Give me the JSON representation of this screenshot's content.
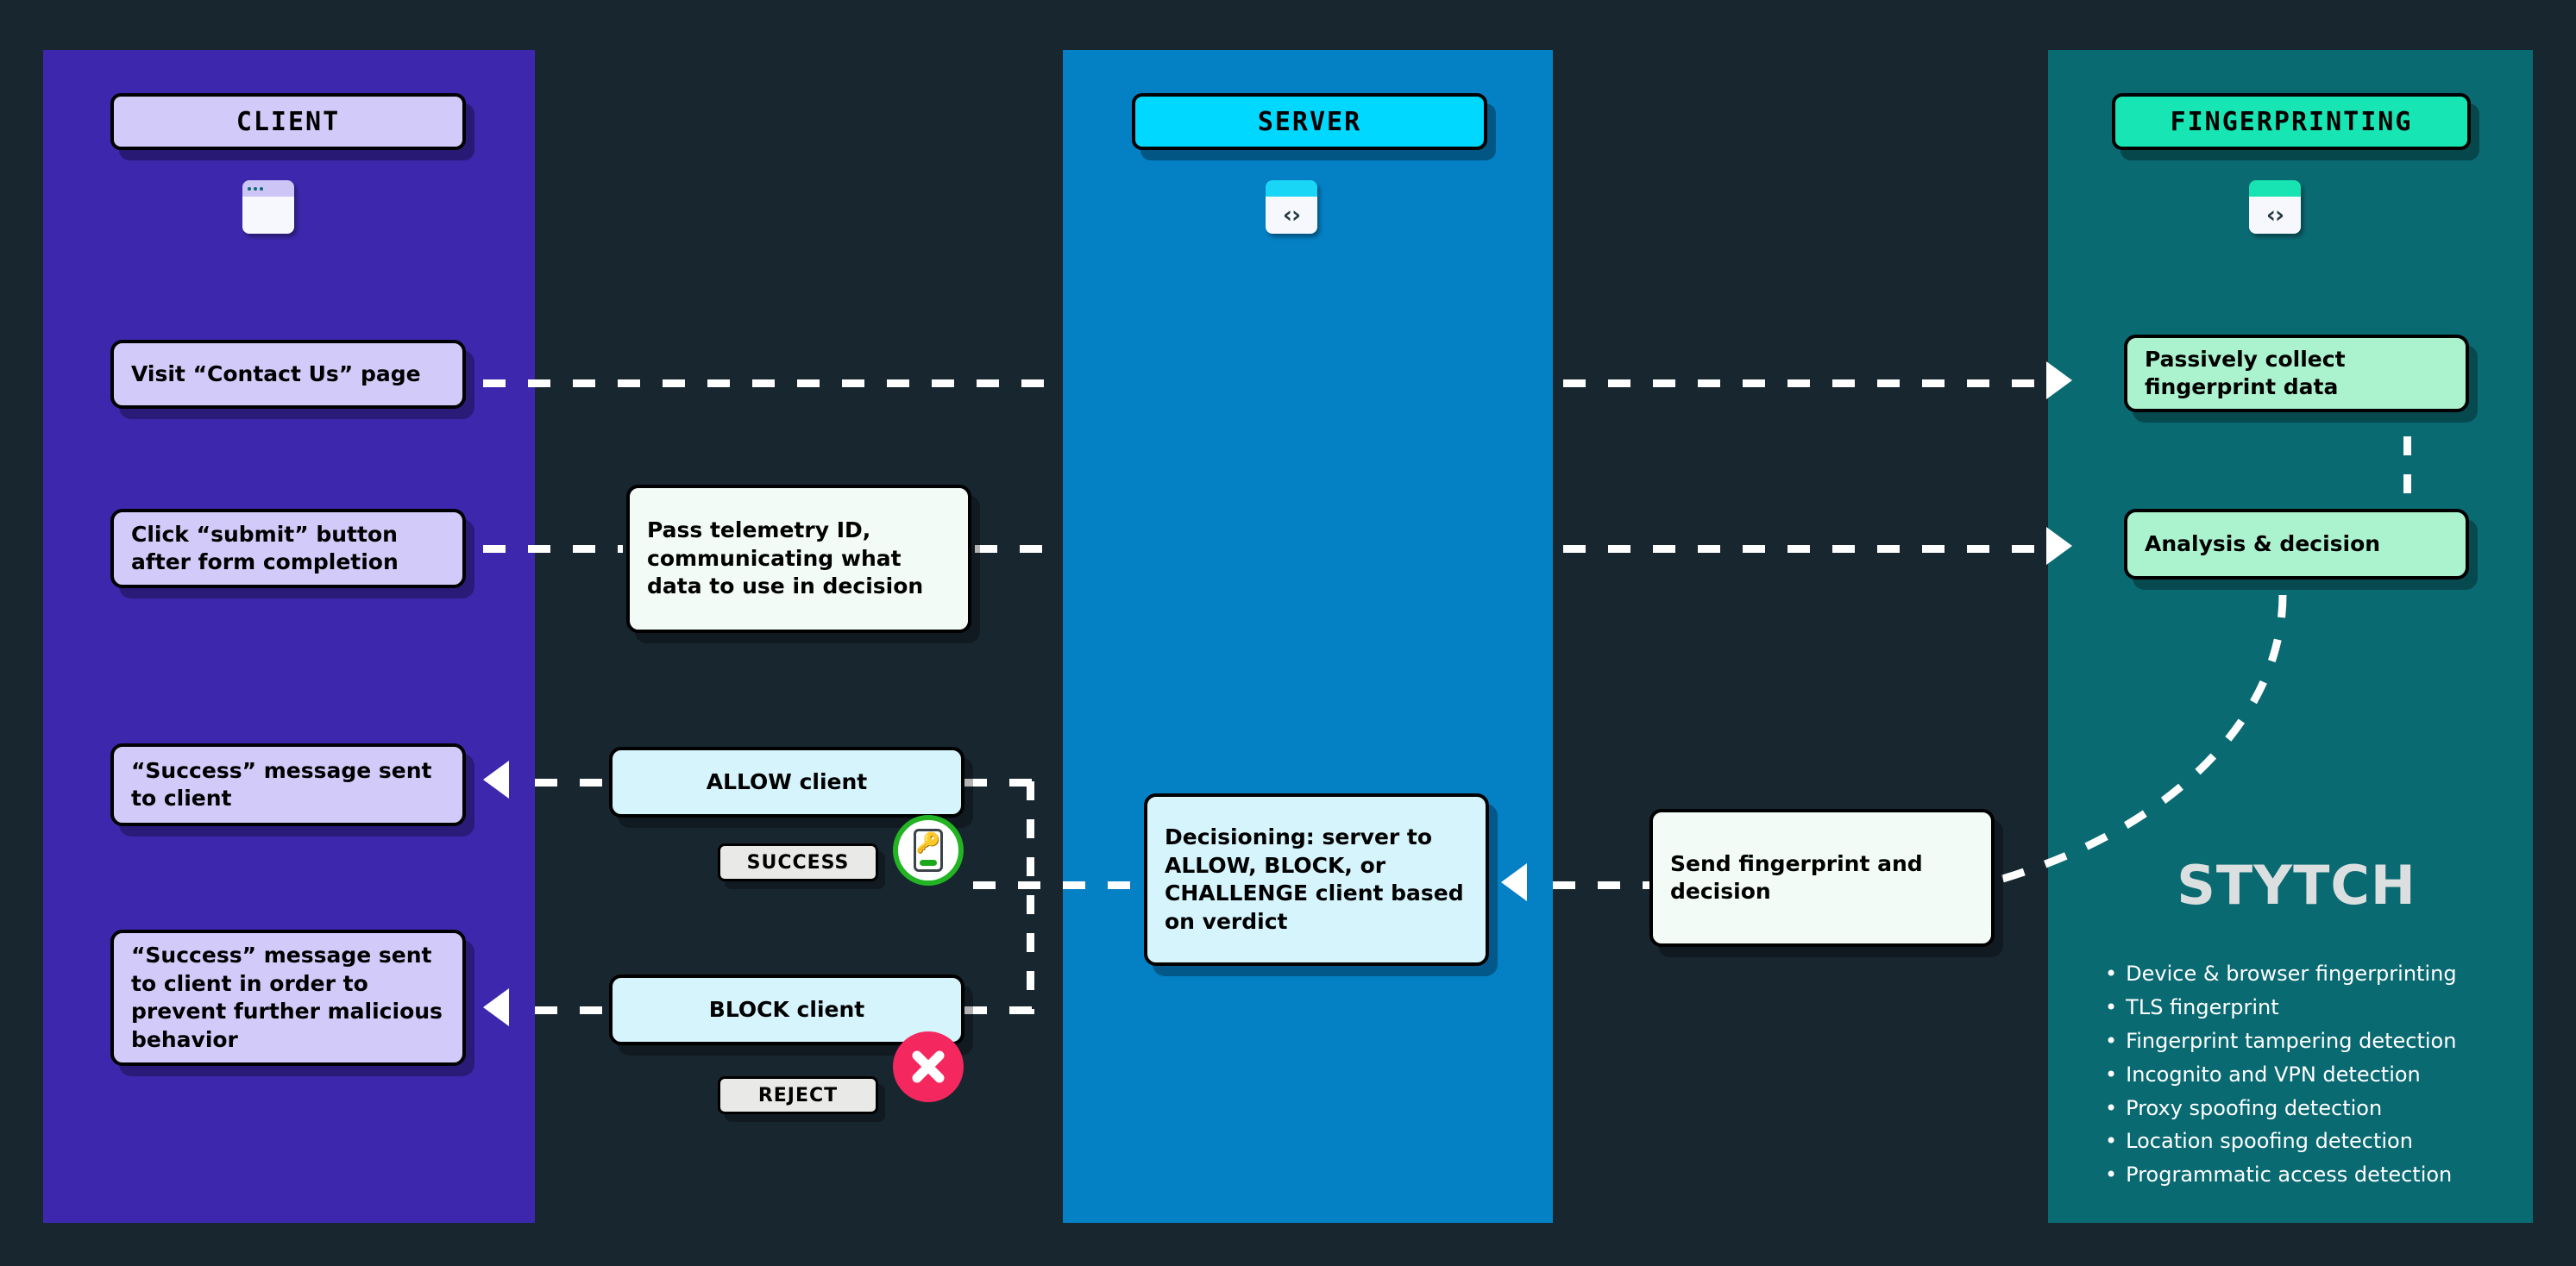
{
  "colors": {
    "background": "#17262f",
    "client_lane": "#3d28ad",
    "server_lane": "#0480c4",
    "fingerprinting_lane": "#0a6a72",
    "client_pill": "#d2caf8",
    "server_pill": "#00d8ff",
    "fingerprinting_pill": "#17e6b4",
    "success_green": "#22b422",
    "reject_red": "#f5275f",
    "connector": "#ffffff"
  },
  "lanes": {
    "client": {
      "title": "CLIENT",
      "icon": "browser-window-icon",
      "steps": [
        {
          "id": "visit",
          "text": "Visit “Contact Us” page"
        },
        {
          "id": "click",
          "text": "Click “submit” button after form completion"
        },
        {
          "id": "success1",
          "text": "“Success” message sent to client"
        },
        {
          "id": "success2",
          "text": "“Success” message sent to client in order to prevent further malicious behavior"
        }
      ]
    },
    "server": {
      "title": "SERVER",
      "icon": "code-window-icon",
      "steps": [
        {
          "id": "decisioning",
          "text": "Decisioning: server to ALLOW, BLOCK, or CHALLENGE client based on verdict"
        }
      ]
    },
    "fingerprinting": {
      "title": "FINGERPRINTING",
      "icon": "code-window-icon",
      "steps": [
        {
          "id": "collect",
          "text": "Passively collect fingerprint data"
        },
        {
          "id": "analysis",
          "text": "Analysis & decision"
        }
      ],
      "brand": "STYTCH",
      "features": [
        "Device & browser fingerprinting",
        "TLS fingerprint",
        "Fingerprint tampering detection",
        "Incognito and VPN detection",
        "Proxy spoofing detection",
        "Location spoofing detection",
        "Programmatic access detection"
      ]
    }
  },
  "notes": {
    "telemetry": "Pass telemetry ID, communicating what data to use in decision",
    "send_fingerprint": "Send fingerprint and decision"
  },
  "decisions": {
    "allow": {
      "label": "ALLOW client",
      "chip": "SUCCESS",
      "badge": "fingerprint-phone-icon"
    },
    "block": {
      "label": "BLOCK client",
      "chip": "REJECT",
      "badge": "x-mark-icon"
    }
  },
  "icons": {
    "code_glyph": "‹›"
  },
  "chart_data": {
    "type": "diagram",
    "title": "Stytch device fingerprinting decisioning flow",
    "lanes": [
      "CLIENT",
      "SERVER",
      "FINGERPRINTING"
    ],
    "nodes": [
      {
        "id": "visit",
        "lane": "CLIENT",
        "label": "Visit “Contact Us” page"
      },
      {
        "id": "click",
        "lane": "CLIENT",
        "label": "Click “submit” button after form completion"
      },
      {
        "id": "success1",
        "lane": "CLIENT",
        "label": "“Success” message sent to client"
      },
      {
        "id": "success2",
        "lane": "CLIENT",
        "label": "“Success” message sent to client in order to prevent further malicious behavior"
      },
      {
        "id": "telemetry",
        "lane": "BETWEEN",
        "label": "Pass telemetry ID, communicating what data to use in decision"
      },
      {
        "id": "allow",
        "lane": "BETWEEN",
        "label": "ALLOW client",
        "status": "SUCCESS"
      },
      {
        "id": "block",
        "lane": "BETWEEN",
        "label": "BLOCK client",
        "status": "REJECT"
      },
      {
        "id": "decisioning",
        "lane": "SERVER",
        "label": "Decisioning: server to ALLOW, BLOCK, or CHALLENGE client based on verdict"
      },
      {
        "id": "sendfp",
        "lane": "BETWEEN",
        "label": "Send fingerprint and decision"
      },
      {
        "id": "collect",
        "lane": "FINGERPRINTING",
        "label": "Passively collect fingerprint data"
      },
      {
        "id": "analysis",
        "lane": "FINGERPRINTING",
        "label": "Analysis & decision"
      }
    ],
    "edges": [
      {
        "from": "visit",
        "to": "collect",
        "style": "dashed",
        "direction": "right"
      },
      {
        "from": "click",
        "to": "telemetry",
        "style": "dashed",
        "direction": "right"
      },
      {
        "from": "telemetry",
        "to": "analysis",
        "style": "dashed",
        "direction": "right"
      },
      {
        "from": "collect",
        "to": "analysis",
        "style": "dashed",
        "direction": "down"
      },
      {
        "from": "analysis",
        "to": "sendfp",
        "style": "dashed-curve",
        "direction": "left"
      },
      {
        "from": "sendfp",
        "to": "decisioning",
        "style": "dashed",
        "direction": "left"
      },
      {
        "from": "decisioning",
        "to": "allow",
        "style": "dashed",
        "direction": "left"
      },
      {
        "from": "decisioning",
        "to": "block",
        "style": "dashed",
        "direction": "left"
      },
      {
        "from": "allow",
        "to": "success1",
        "style": "dashed",
        "direction": "left"
      },
      {
        "from": "block",
        "to": "success2",
        "style": "dashed",
        "direction": "left"
      }
    ]
  }
}
